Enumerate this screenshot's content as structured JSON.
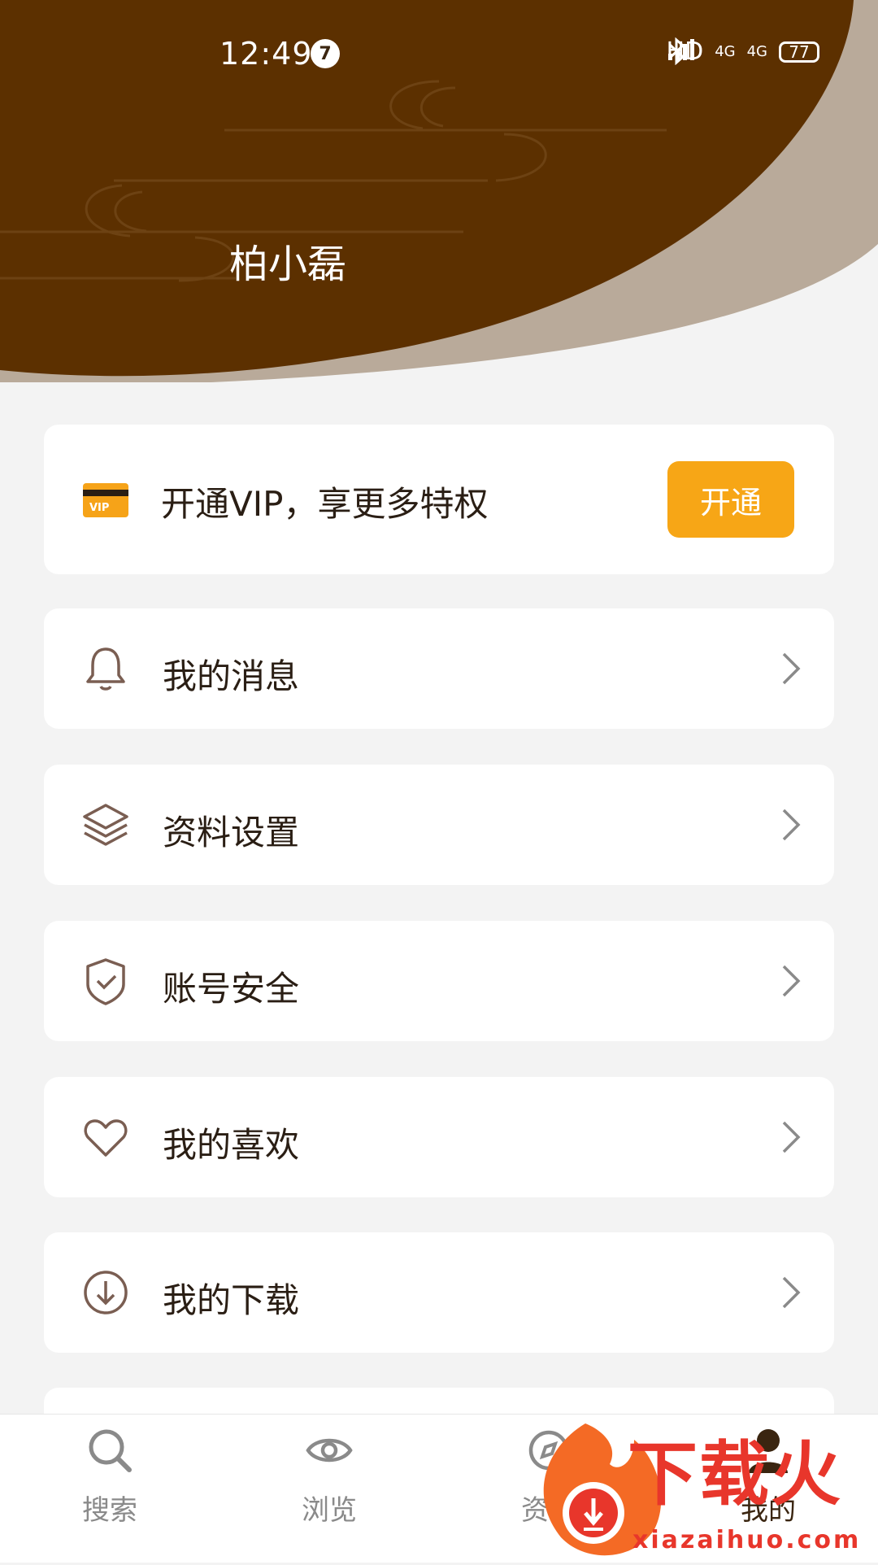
{
  "status_bar": {
    "time": "12:49",
    "notification_count": "7",
    "network_label": "HD",
    "signal_label": "4G",
    "battery_level": "77"
  },
  "profile": {
    "user_name": "柏小磊"
  },
  "vip": {
    "text": "开通VIP，享更多特权",
    "button_label": "开通",
    "icon_label": "VIP"
  },
  "menu": [
    {
      "label": "我的消息",
      "icon": "bell-icon"
    },
    {
      "label": "资料设置",
      "icon": "layers-icon"
    },
    {
      "label": "账号安全",
      "icon": "shield-check-icon"
    },
    {
      "label": "我的喜欢",
      "icon": "heart-icon"
    },
    {
      "label": "我的下载",
      "icon": "download-circle-icon"
    }
  ],
  "bottom_nav": [
    {
      "label": "搜索",
      "icon": "search-icon"
    },
    {
      "label": "浏览",
      "icon": "eye-icon"
    },
    {
      "label": "资讯",
      "icon": "compass-icon"
    },
    {
      "label": "我的",
      "icon": "user-icon",
      "active": true
    }
  ],
  "watermark": {
    "brand": "下载火",
    "url": "xiazaihuo.com"
  },
  "colors": {
    "header_brown": "#5c3000",
    "accent_orange": "#f7a616",
    "background": "#f3f3f3"
  }
}
